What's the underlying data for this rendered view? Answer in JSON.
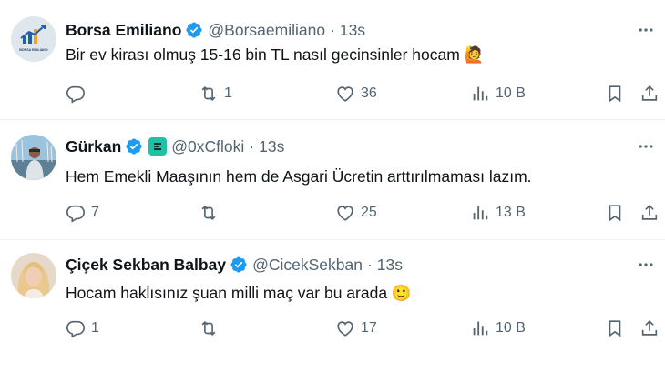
{
  "tweets": [
    {
      "name": "Borsa Emiliano",
      "handle": "@Borsaemiliano",
      "separator": "·",
      "time": "13s",
      "avatar_text": "BORSA EMILIANO",
      "text": "Bir ev kirası olmuş 15-16 bin TL nasıl gecinsinler hocam 🙋",
      "replies": "",
      "reposts": "1",
      "likes": "36",
      "views": "10 B"
    },
    {
      "name": "Gürkan",
      "handle": "@0xCfloki",
      "separator": "·",
      "time": "13s",
      "text": "Hem Emekli Maaşının hem de Asgari Ücretin arttırılmaması lazım.",
      "replies": "7",
      "reposts": "",
      "likes": "25",
      "views": "13 B"
    },
    {
      "name": "Çiçek Sekban Balbay",
      "handle": "@CicekSekban",
      "separator": "·",
      "time": "13s",
      "text": "Hocam haklısınız şuan milli maç var bu arada 🙂",
      "replies": "1",
      "reposts": "",
      "likes": "17",
      "views": "10 B"
    }
  ],
  "colors": {
    "verified": "#1d9bf0",
    "secondary_text": "#536471",
    "primary_text": "#0f1419",
    "affiliate_badge": "#1fc1a4"
  },
  "icons": [
    "verified-icon",
    "more-icon",
    "reply-icon",
    "repost-icon",
    "like-icon",
    "views-icon",
    "bookmark-icon",
    "share-icon"
  ]
}
